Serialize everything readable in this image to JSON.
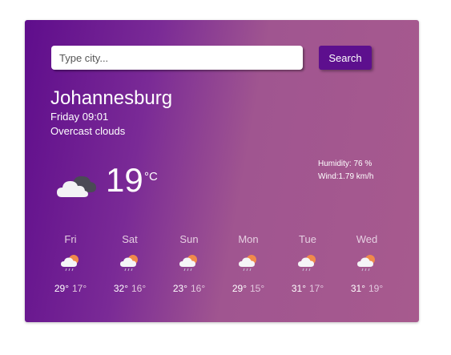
{
  "search": {
    "placeholder": "Type city...",
    "value": "",
    "button_label": "Search"
  },
  "current": {
    "city": "Johannesburg",
    "datetime": "Friday 09:01",
    "condition": "Overcast clouds",
    "temperature": "19",
    "unit": "°C",
    "humidity": "Humidity: 76 %",
    "wind": "Wind:1.79 km/h",
    "icon": "overcast-clouds-icon"
  },
  "forecast": [
    {
      "day": "Fri",
      "max": "29°",
      "min": "17°",
      "icon": "sun-cloud-rain-icon"
    },
    {
      "day": "Sat",
      "max": "32°",
      "min": "16°",
      "icon": "sun-cloud-rain-icon"
    },
    {
      "day": "Sun",
      "max": "23°",
      "min": "16°",
      "icon": "sun-cloud-rain-icon"
    },
    {
      "day": "Mon",
      "max": "29°",
      "min": "15°",
      "icon": "sun-cloud-rain-icon"
    },
    {
      "day": "Tue",
      "max": "31°",
      "min": "17°",
      "icon": "sun-cloud-rain-icon"
    },
    {
      "day": "Wed",
      "max": "31°",
      "min": "19°",
      "icon": "sun-cloud-rain-icon"
    }
  ],
  "colors": {
    "gradient_start": "#5f0d8c",
    "gradient_end": "#a75a8e",
    "button": "#5d0f8e"
  }
}
